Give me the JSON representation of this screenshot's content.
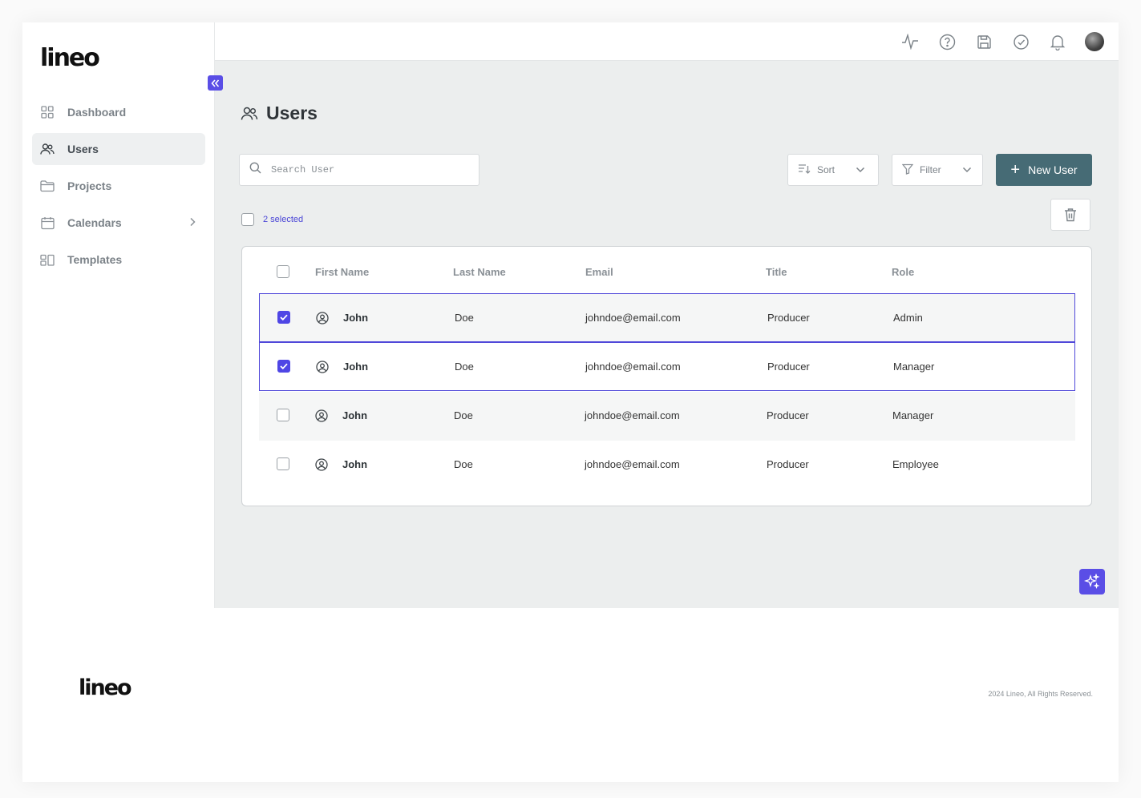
{
  "brand": {
    "logo": "lineo"
  },
  "sidebar": {
    "items": [
      {
        "label": "Dashboard",
        "icon": "grid-icon"
      },
      {
        "label": "Users",
        "icon": "users-icon",
        "active": true
      },
      {
        "label": "Projects",
        "icon": "folder-icon"
      },
      {
        "label": "Calendars",
        "icon": "calendar-icon",
        "has_submenu": true
      },
      {
        "label": "Templates",
        "icon": "templates-icon"
      }
    ]
  },
  "topbar": {
    "icons": [
      "activity-icon",
      "help-icon",
      "save-icon",
      "check-circle-icon",
      "bell-icon",
      "avatar"
    ]
  },
  "page": {
    "title": "Users",
    "search_placeholder": "Search User",
    "sort_label": "Sort",
    "filter_label": "Filter",
    "new_user_label": "New User",
    "selected_text": "2 selected"
  },
  "table": {
    "headers": [
      "First Name",
      "Last Name",
      "Email",
      "Title",
      "Role"
    ],
    "rows": [
      {
        "first": "John",
        "last": "Doe",
        "email": "johndoe@email.com",
        "title": "Producer",
        "role": "Admin",
        "checked": true
      },
      {
        "first": "John",
        "last": "Doe",
        "email": "johndoe@email.com",
        "title": "Producer",
        "role": "Manager",
        "checked": true
      },
      {
        "first": "John",
        "last": "Doe",
        "email": "johndoe@email.com",
        "title": "Producer",
        "role": "Manager",
        "checked": false
      },
      {
        "first": "John",
        "last": "Doe",
        "email": "johndoe@email.com",
        "title": "Producer",
        "role": "Employee",
        "checked": false
      }
    ]
  },
  "footer": {
    "logo": "lineo",
    "copyright": "2024 Lineo, All Rights Reserved."
  },
  "colors": {
    "accent": "#5a4ee6",
    "primary_button": "#466b75",
    "main_bg": "#eceeee"
  }
}
